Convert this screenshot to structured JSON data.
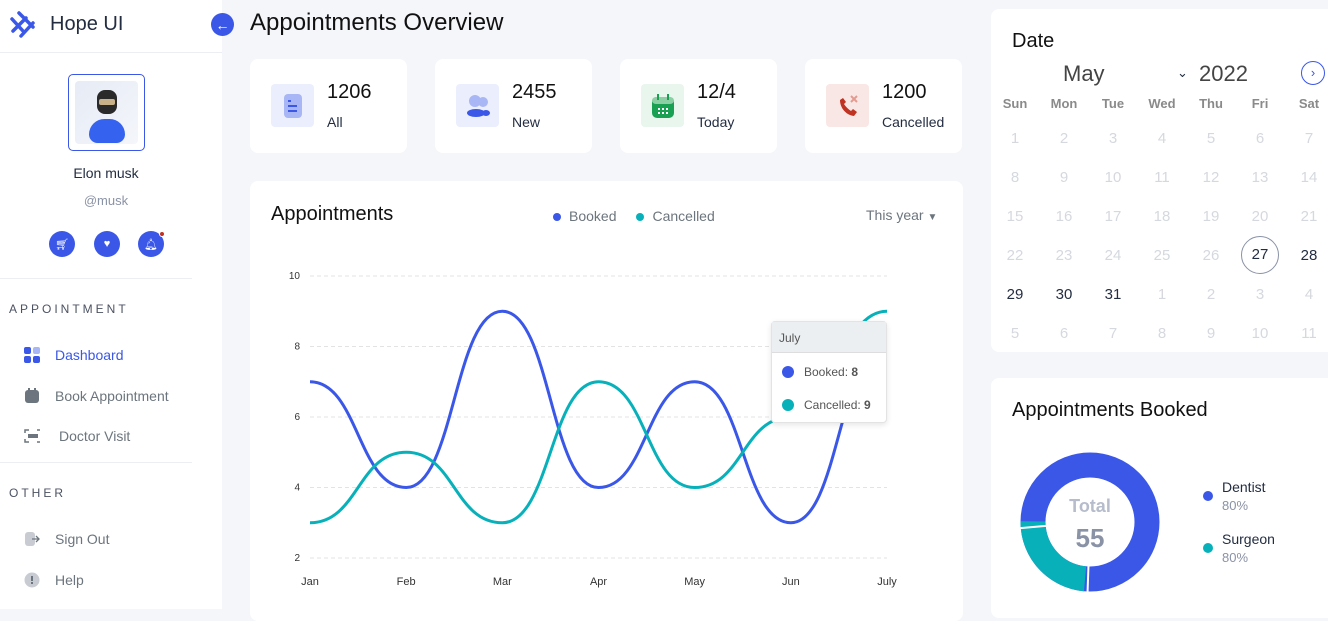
{
  "app": {
    "title": "Hope UI"
  },
  "profile": {
    "name": "Elon musk",
    "handle": "@musk"
  },
  "sidebar": {
    "sections": [
      {
        "title": "APPOINTMENT",
        "items": [
          {
            "label": "Dashboard",
            "icon": "dashboard-icon",
            "active": true
          },
          {
            "label": "Book Appointment",
            "icon": "calendar-icon"
          },
          {
            "label": "Doctor Visit",
            "icon": "scan-icon"
          }
        ]
      },
      {
        "title": "OTHER",
        "items": [
          {
            "label": "Sign Out",
            "icon": "logout-icon"
          },
          {
            "label": "Help",
            "icon": "info-icon"
          }
        ]
      }
    ]
  },
  "header": {
    "title": "Appointments Overview"
  },
  "stats": [
    {
      "value": "1206",
      "label": "All",
      "icon": "document-icon",
      "color": "#3a57e8",
      "bg": "#ebeefd"
    },
    {
      "value": "2455",
      "label": "New",
      "icon": "users-icon",
      "color": "#3a57e8",
      "bg": "#ebeefd"
    },
    {
      "value": "12/4",
      "label": "Today",
      "icon": "calendar-icon",
      "color": "#1aa053",
      "bg": "#e8f6ee"
    },
    {
      "value": "1200",
      "label": "Cancelled",
      "icon": "phone-cancel-icon",
      "color": "#c03221",
      "bg": "#f9e7e5"
    }
  ],
  "appointments_chart": {
    "title": "Appointments",
    "filter": "This year",
    "tooltip": {
      "title": "July",
      "booked_label": "Booked:",
      "booked": "8",
      "cancelled_label": "Cancelled:",
      "cancelled": "9"
    }
  },
  "chart_data": {
    "type": "line",
    "categories": [
      "Jan",
      "Feb",
      "Mar",
      "Apr",
      "May",
      "Jun",
      "July"
    ],
    "series": [
      {
        "name": "Booked",
        "color": "#3a57e8",
        "values": [
          7,
          4,
          9,
          4,
          7,
          3,
          8
        ]
      },
      {
        "name": "Cancelled",
        "color": "#08b1ba",
        "values": [
          3,
          5,
          3,
          7,
          4,
          6,
          9
        ]
      }
    ],
    "yticks": [
      2,
      4,
      6,
      8,
      10
    ],
    "ylim": [
      2,
      10
    ],
    "grid": true,
    "legend": "top-center"
  },
  "calendar": {
    "title": "Date",
    "month": "May",
    "year": "2022",
    "selected": "27",
    "weekdays": [
      "Sun",
      "Mon",
      "Tue",
      "Wed",
      "Thu",
      "Fri",
      "Sat"
    ],
    "days": [
      [
        "1",
        "2",
        "3",
        "4",
        "5",
        "6",
        "7"
      ],
      [
        "8",
        "9",
        "10",
        "11",
        "12",
        "13",
        "14"
      ],
      [
        "15",
        "16",
        "17",
        "18",
        "19",
        "20",
        "21"
      ],
      [
        "22",
        "23",
        "24",
        "25",
        "26",
        "27",
        "28"
      ],
      [
        "29",
        "30",
        "31",
        "1",
        "2",
        "3",
        "4"
      ],
      [
        "5",
        "6",
        "7",
        "8",
        "9",
        "10",
        "11"
      ]
    ]
  },
  "booked": {
    "title": "Appointments Booked",
    "total_label": "Total",
    "total": "55",
    "legend": [
      {
        "label": "Dentist",
        "value": "80%",
        "color": "#3a57e8"
      },
      {
        "label": "Surgeon",
        "value": "80%",
        "color": "#08b1ba"
      }
    ]
  }
}
